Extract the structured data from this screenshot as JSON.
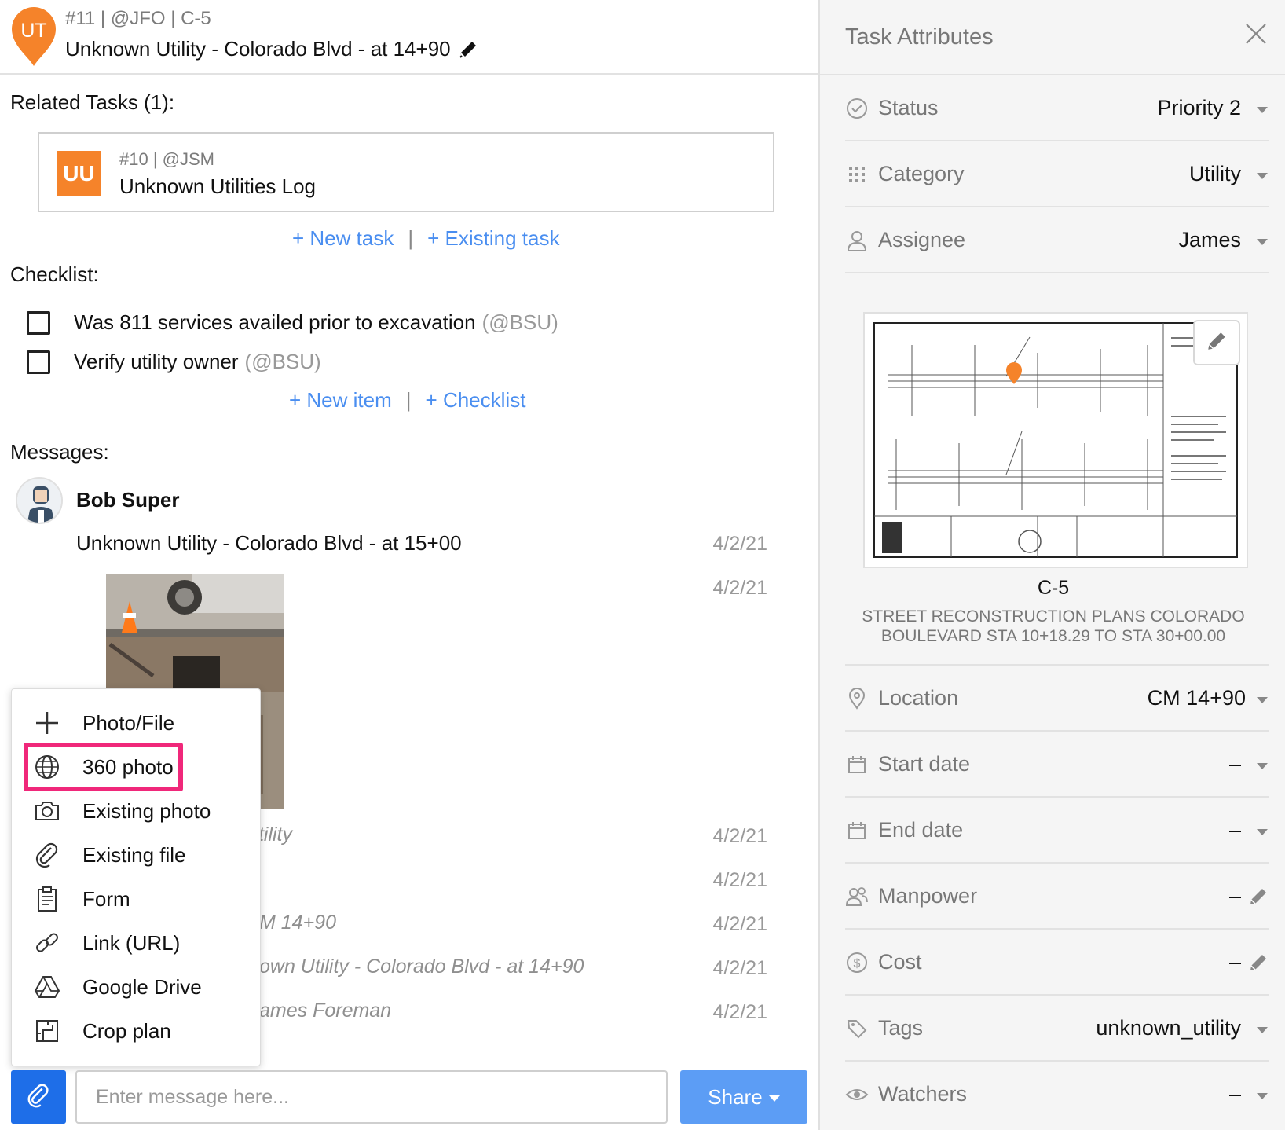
{
  "task": {
    "badge": "UT",
    "ref": "#11 | @JFO | C-5",
    "title": "Unknown Utility - Colorado Blvd - at 14+90"
  },
  "related": {
    "heading": "Related Tasks (1):",
    "card": {
      "badge": "UU",
      "ref": "#10 | @JSM",
      "title": "Unknown Utilities Log"
    },
    "new_task": "+ New task",
    "existing_task": "+ Existing task",
    "sep": "|"
  },
  "checklist": {
    "heading": "Checklist:",
    "items": [
      {
        "text": "Was 811 services availed prior to excavation",
        "user": "(@BSU)"
      },
      {
        "text": "Verify utility owner",
        "user": "(@BSU)"
      }
    ],
    "new_item": "+ New item",
    "add_checklist": "+ Checklist",
    "sep": "|"
  },
  "messages": {
    "heading": "Messages:",
    "author": "Bob Super",
    "first_text": "Unknown Utility - Colorado Blvd - at 15+00",
    "dates": [
      "4/2/21",
      "4/2/21",
      "4/2/21",
      "4/2/21",
      "4/2/21",
      "4/2/21",
      "4/2/21"
    ],
    "partial": [
      "Itility",
      "M 14+90",
      "own Utility - Colorado Blvd - at 14+90",
      "ames Foreman"
    ]
  },
  "attach_menu": {
    "items": [
      {
        "label": "Photo/File",
        "icon": "plus-icon"
      },
      {
        "label": "360 photo",
        "icon": "globe-icon"
      },
      {
        "label": "Existing photo",
        "icon": "camera-icon"
      },
      {
        "label": "Existing file",
        "icon": "paperclip-icon"
      },
      {
        "label": "Form",
        "icon": "clipboard-icon"
      },
      {
        "label": "Link (URL)",
        "icon": "link-icon"
      },
      {
        "label": "Google Drive",
        "icon": "google-drive-icon"
      },
      {
        "label": "Crop plan",
        "icon": "crop-icon"
      }
    ],
    "highlighted": "360 photo"
  },
  "composer": {
    "placeholder": "Enter message here...",
    "share": "Share"
  },
  "attributes": {
    "title": "Task Attributes",
    "rows_top": [
      {
        "label": "Status",
        "value": "Priority 2",
        "icon": "check-circle-icon"
      },
      {
        "label": "Category",
        "value": "Utility",
        "icon": "grid-icon"
      },
      {
        "label": "Assignee",
        "value": "James",
        "icon": "user-icon"
      }
    ],
    "plan": {
      "name": "C-5",
      "description": "STREET RECONSTRUCTION PLANS COLORADO BOULEVARD STA 10+18.29 TO STA 30+00.00"
    },
    "rows_bottom": [
      {
        "label": "Location",
        "value": "CM 14+90",
        "icon": "pin-icon",
        "control": "dropdown"
      },
      {
        "label": "Start date",
        "value": "–",
        "icon": "calendar-icon",
        "control": "dropdown"
      },
      {
        "label": "End date",
        "value": "–",
        "icon": "calendar-icon",
        "control": "dropdown"
      },
      {
        "label": "Manpower",
        "value": "–",
        "icon": "people-icon",
        "control": "edit"
      },
      {
        "label": "Cost",
        "value": "–",
        "icon": "dollar-icon",
        "control": "edit"
      },
      {
        "label": "Tags",
        "value": "unknown_utility",
        "icon": "tag-icon",
        "control": "dropdown"
      },
      {
        "label": "Watchers",
        "value": "–",
        "icon": "eye-icon",
        "control": "dropdown"
      }
    ]
  },
  "colors": {
    "accent_orange": "#f5832a",
    "link_blue": "#4a8ef0",
    "primary_blue": "#1e6ee8",
    "share_blue": "#5c9df5",
    "highlight_pink": "#f0287a"
  }
}
